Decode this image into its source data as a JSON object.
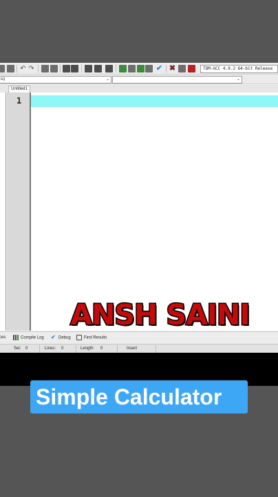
{
  "toolbar": {
    "compiler": "TDM-GCC 4.9.2 64-bit Release"
  },
  "combos": {
    "left": "is)",
    "right": ""
  },
  "editor": {
    "tab": "Untitled1",
    "line_numbers": [
      "1"
    ]
  },
  "bottom_tabs": {
    "resources": "rces",
    "compile_log": "Compile Log",
    "debug": "Debug",
    "find_results": "Find Results"
  },
  "status_bar": {
    "sel_label": "Sel:",
    "sel_value": "0",
    "lines_label": "Lines:",
    "lines_value": "0",
    "length_label": "Length:",
    "length_value": "0",
    "mode": "Insert"
  },
  "overlay": {
    "watermark": "ANSH SAINI",
    "caption": "Simple Calculator"
  },
  "colors": {
    "active_line": "#8ff7f7",
    "watermark_red": "#c40b0b",
    "caption_blue": "#3ea7f5"
  }
}
